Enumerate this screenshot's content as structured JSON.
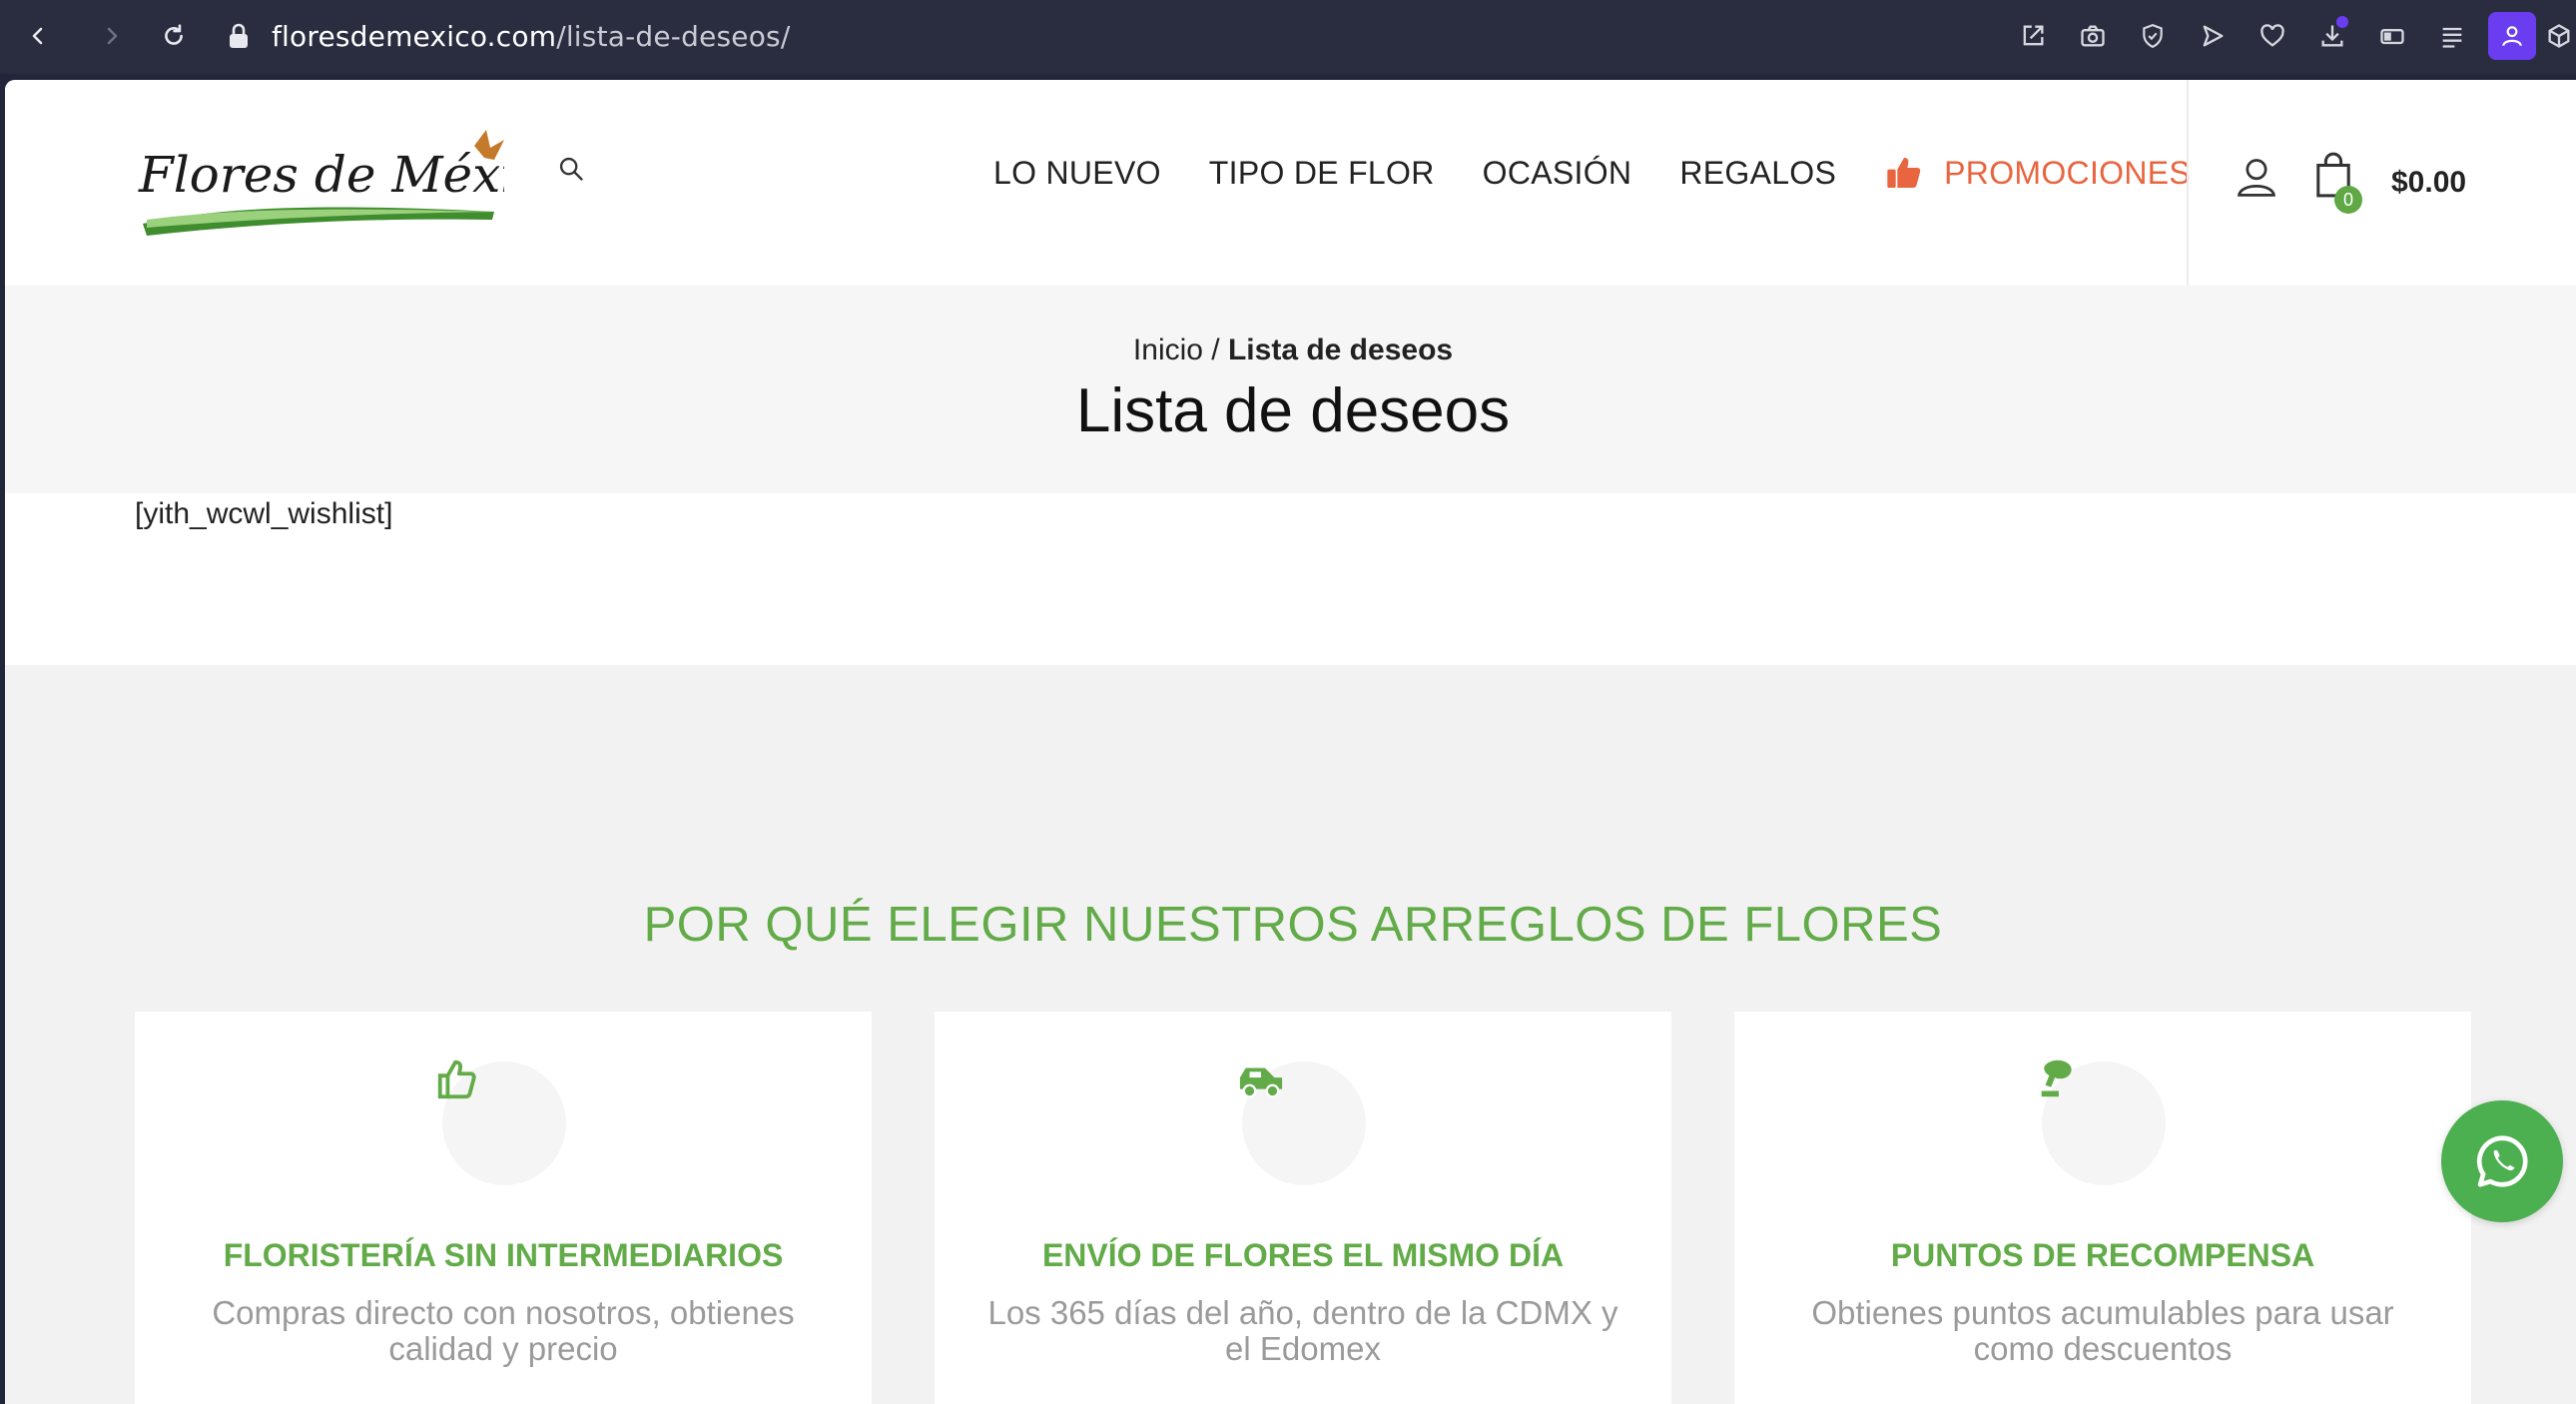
{
  "browser": {
    "url_domain": "floresdemexico.com",
    "url_path": "/lista-de-deseos/"
  },
  "header": {
    "logo_text": "Flores de México",
    "nav": [
      {
        "label": "LO NUEVO"
      },
      {
        "label": "TIPO DE FLOR"
      },
      {
        "label": "OCASIÓN"
      },
      {
        "label": "REGALOS"
      },
      {
        "label": "PROMOCIONES"
      }
    ],
    "cart_count": "0",
    "cart_total": "$0.00"
  },
  "title_section": {
    "breadcrumb_home": "Inicio",
    "breadcrumb_sep": " / ",
    "breadcrumb_current": "Lista de deseos",
    "page_title": "Lista de deseos"
  },
  "content": {
    "shortcode": "[yith_wcwl_wishlist]"
  },
  "why_section": {
    "title": "POR QUÉ ELEGIR NUESTROS ARREGLOS DE FLORES",
    "cards": [
      {
        "title": "FLORISTERÍA SIN INTERMEDIARIOS",
        "text": "Compras directo con nosotros, obtienes calidad y precio",
        "icon": "thumbs-up-icon"
      },
      {
        "title": "ENVÍO DE FLORES EL MISMO DÍA",
        "text": "Los 365 días del año, dentro de la CDMX y el Edomex",
        "icon": "delivery-car-icon"
      },
      {
        "title": "PUNTOS DE RECOMPENSA",
        "text": "Obtienes puntos acumulables para usar como descuentos",
        "icon": "badge-icon"
      }
    ]
  },
  "colors": {
    "accent_green": "#62ab48",
    "promo_orange": "#e8653f",
    "whatsapp_green": "#4caf50"
  }
}
